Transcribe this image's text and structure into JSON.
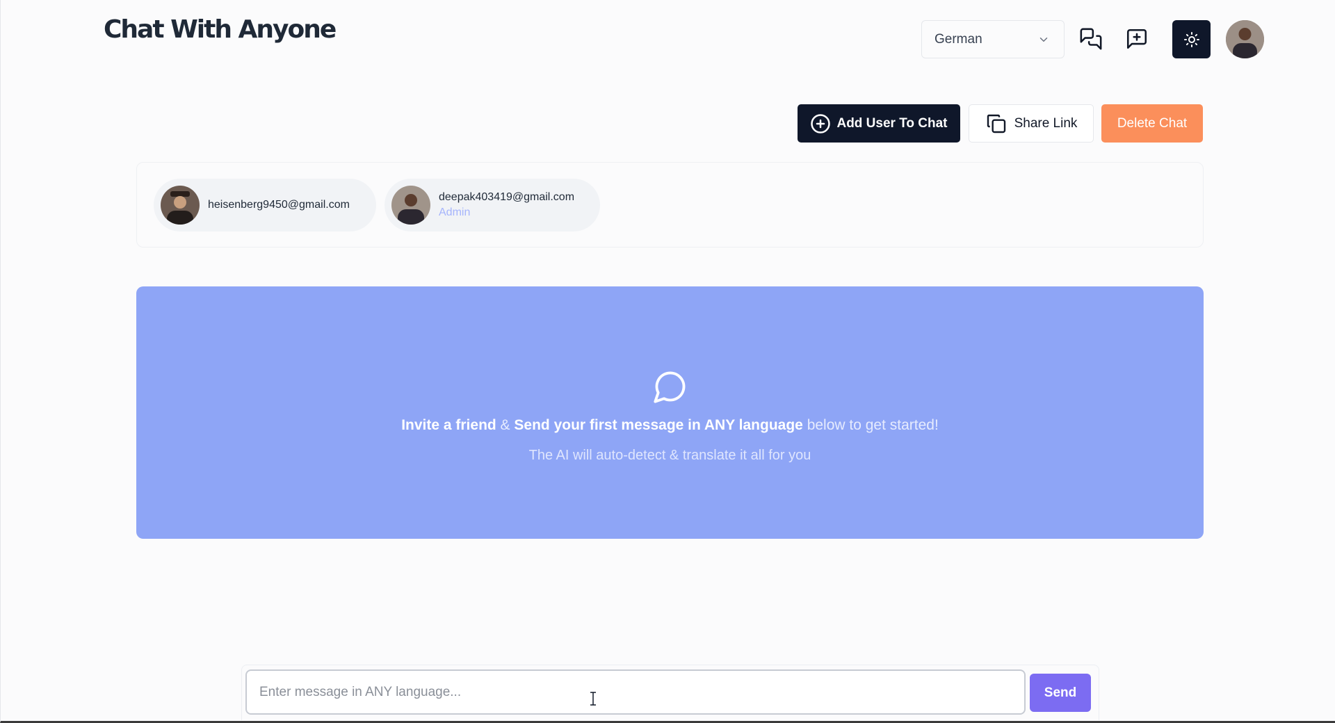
{
  "header": {
    "logo": "Chat With Anyone",
    "language": {
      "selected": "German"
    },
    "icons": [
      "chats-icon",
      "new-chat-icon",
      "sun-icon"
    ]
  },
  "actions": {
    "add_user": "Add User To Chat",
    "share_link": "Share Link",
    "delete_chat": "Delete Chat"
  },
  "members": [
    {
      "email": "heisenberg9450@gmail.com",
      "role": ""
    },
    {
      "email": "deepak403419@gmail.com",
      "role": "Admin"
    }
  ],
  "empty_state": {
    "part1": "Invite a friend",
    "amp": " & ",
    "part2": "Send your first message in ANY language",
    "part3": " below to get started!",
    "subtitle": "The AI will auto-detect & translate it all for you"
  },
  "composer": {
    "placeholder": "Enter message in ANY language...",
    "send": "Send"
  },
  "colors": {
    "primary_dark": "#0f172a",
    "delete_orange": "#fb8f5b",
    "panel_blue": "#8ea5f6",
    "send_purple": "#7c6cf2",
    "admin_text": "#a5b4fc"
  }
}
